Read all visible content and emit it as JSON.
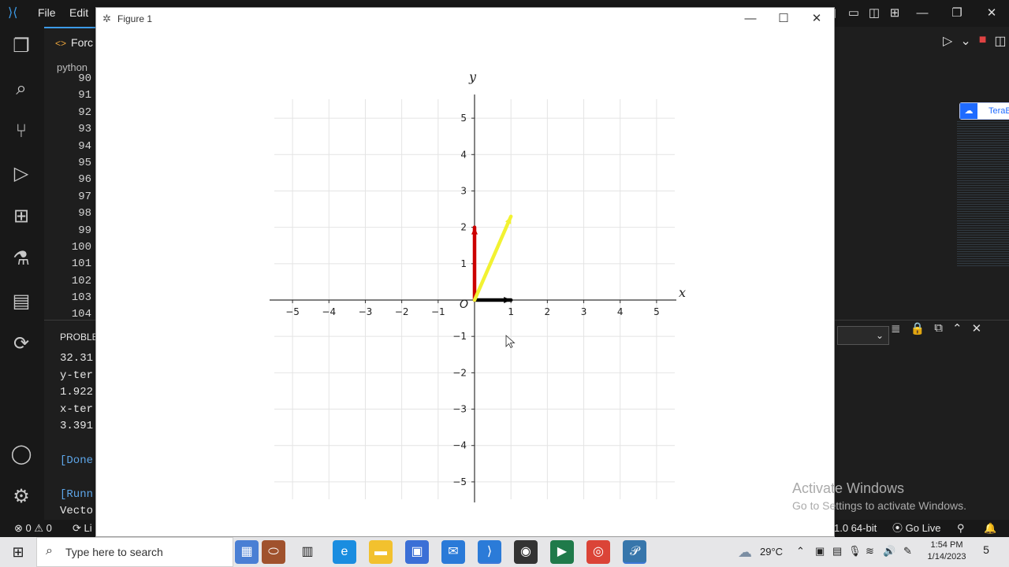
{
  "vscode": {
    "menu": [
      "File",
      "Edit"
    ],
    "tab_label": "Forc",
    "breadcrumb": "python",
    "line_numbers": [
      "90",
      "91",
      "92",
      "93",
      "94",
      "95",
      "96",
      "97",
      "98",
      "99",
      "100",
      "101",
      "102",
      "103",
      "104"
    ],
    "panel_title": "PROBLE",
    "panel_lines": [
      {
        "text": "32.31",
        "style": "normal"
      },
      {
        "text": "y-ter",
        "style": "normal"
      },
      {
        "text": "1.922",
        "style": "normal"
      },
      {
        "text": "x-ter",
        "style": "normal"
      },
      {
        "text": "3.391",
        "style": "normal"
      },
      {
        "text": "",
        "style": "normal"
      },
      {
        "text": "[Done",
        "style": "blue"
      },
      {
        "text": "",
        "style": "normal"
      },
      {
        "text": "[Runn",
        "style": "blue"
      },
      {
        "text": "Vecto",
        "style": "normal"
      }
    ],
    "status_left": "⊗ 0 ⚠ 0",
    "status_li": "Li",
    "status_python": "1.0 64-bit",
    "status_golive": "Go Live",
    "terabox_label": "TeraBox"
  },
  "figure": {
    "title": "Figure 1",
    "xlabel": "x",
    "ylabel": "y",
    "origin_label": "O",
    "controls": {
      "minimize": "—",
      "maximize": "☐",
      "close": "✕"
    }
  },
  "chart_data": {
    "type": "line",
    "title": "",
    "xlabel": "x",
    "ylabel": "y",
    "xlim": [
      -5.5,
      5.5
    ],
    "ylim": [
      -5.5,
      5.5
    ],
    "xticks": [
      -5,
      -4,
      -3,
      -2,
      -1,
      1,
      2,
      3,
      4,
      5
    ],
    "yticks": [
      5,
      4,
      3,
      2,
      1,
      -1,
      -2,
      -3,
      -4,
      -5
    ],
    "xtick_labels": [
      "−5",
      "−4",
      "−3",
      "−2",
      "−1",
      "1",
      "2",
      "3",
      "4",
      "5"
    ],
    "ytick_labels": [
      "5",
      "4",
      "3",
      "2",
      "1",
      "−1",
      "−2",
      "−3",
      "−4",
      "−5"
    ],
    "grid": true,
    "series": [
      {
        "x": [
          0,
          1
        ],
        "y": [
          0,
          0
        ],
        "color": "#000000"
      },
      {
        "x": [
          0,
          0
        ],
        "y": [
          0,
          2
        ],
        "color": "#cc0000"
      },
      {
        "x": [
          0,
          1
        ],
        "y": [
          0,
          2.3
        ],
        "color": "#f2f232"
      }
    ]
  },
  "watermark": {
    "title": "Activate Windows",
    "subtitle": "Go to Settings to activate Windows."
  },
  "taskbar": {
    "search_placeholder": "Type here to search",
    "weather": "29°C",
    "time": "1:54 PM",
    "date": "1/14/2023",
    "notification_count": "5"
  }
}
